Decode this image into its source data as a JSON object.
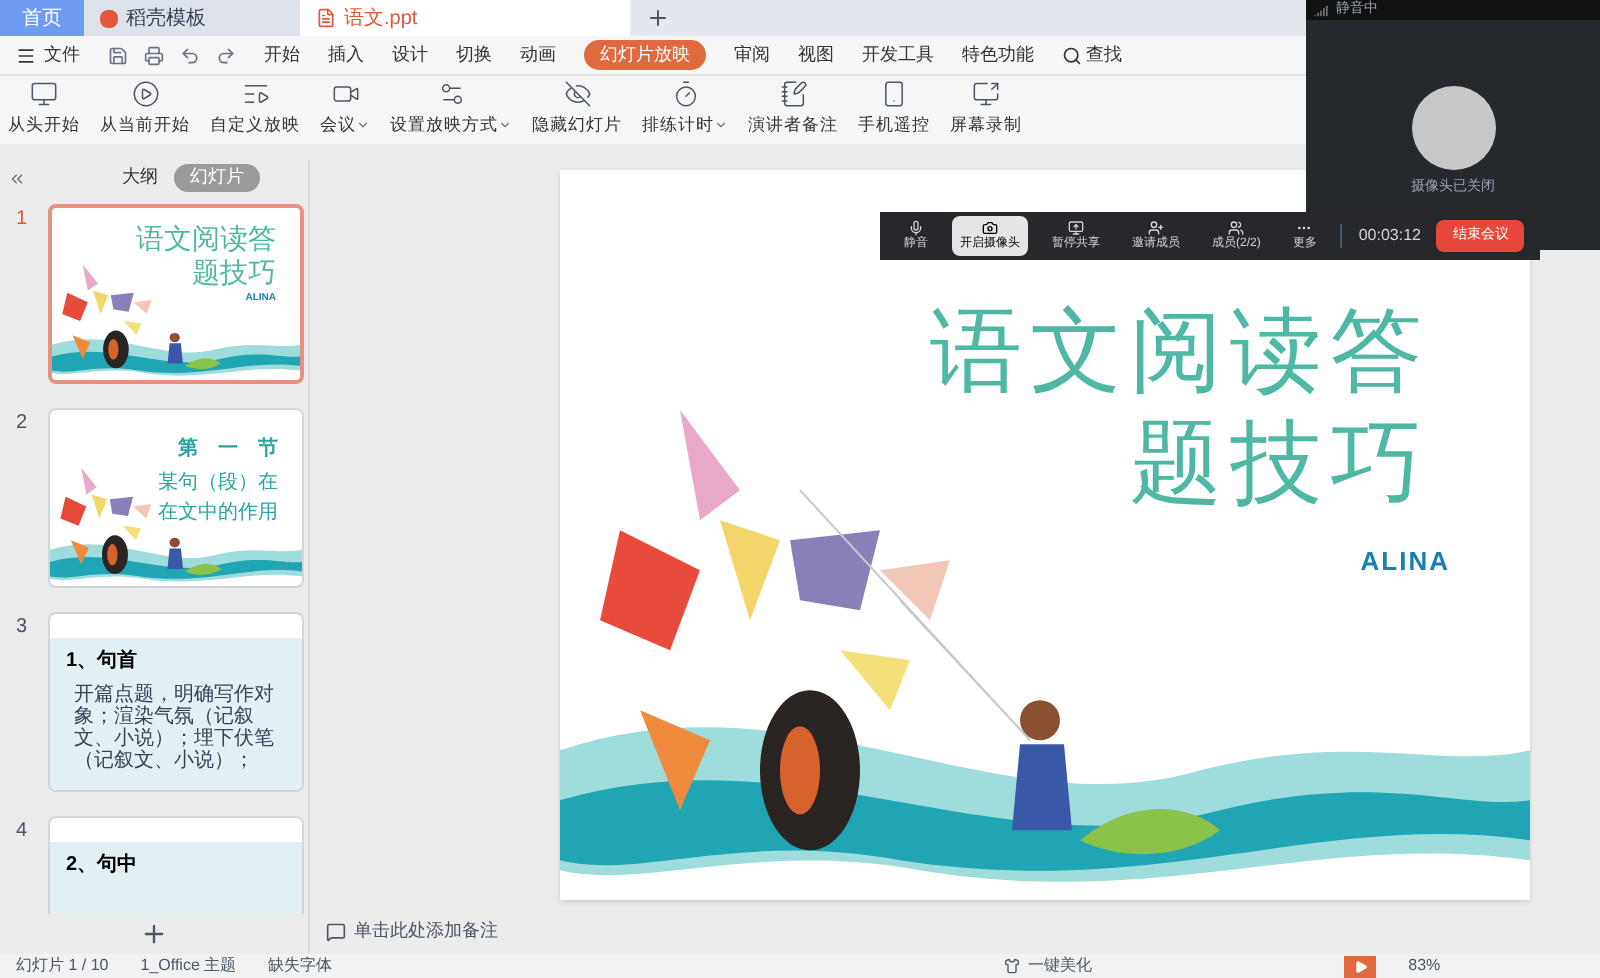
{
  "tabs": [
    {
      "label": "首页",
      "kind": "home",
      "selected": false
    },
    {
      "label": "稻壳模板",
      "kind": "template",
      "selected": false
    },
    {
      "label": "语文.ppt",
      "kind": "doc",
      "selected": true
    }
  ],
  "menu": {
    "file": "文件",
    "items": [
      {
        "label": "开始",
        "selected": false
      },
      {
        "label": "插入",
        "selected": false
      },
      {
        "label": "设计",
        "selected": false
      },
      {
        "label": "切换",
        "selected": false
      },
      {
        "label": "动画",
        "selected": false
      },
      {
        "label": "幻灯片放映",
        "selected": true
      },
      {
        "label": "审阅",
        "selected": false
      },
      {
        "label": "视图",
        "selected": false
      },
      {
        "label": "开发工具",
        "selected": false
      },
      {
        "label": "特色功能",
        "selected": false
      }
    ],
    "search": "查找"
  },
  "ribbon": [
    {
      "label": "从头开始",
      "kind": "monitor",
      "dropdown": false
    },
    {
      "label": "从当前开始",
      "kind": "play",
      "dropdown": false
    },
    {
      "label": "自定义放映",
      "kind": "list",
      "dropdown": false
    },
    {
      "label": "会议",
      "kind": "meeting",
      "dropdown": true
    },
    {
      "label": "设置放映方式",
      "kind": "settings",
      "dropdown": true
    },
    {
      "label": "隐藏幻灯片",
      "kind": "hide",
      "dropdown": false
    },
    {
      "label": "排练计时",
      "kind": "timer",
      "dropdown": true
    },
    {
      "label": "演讲者备注",
      "kind": "notes",
      "dropdown": false
    },
    {
      "label": "手机遥控",
      "kind": "phone",
      "dropdown": false
    },
    {
      "label": "屏幕录制",
      "kind": "record",
      "dropdown": false
    }
  ],
  "panel": {
    "tabs": [
      {
        "label": "大纲",
        "selected": false
      },
      {
        "label": "幻灯片",
        "selected": true
      }
    ],
    "slides": [
      {
        "number": "1",
        "kind": "title",
        "selected": true,
        "lines": [
          "语文阅读答",
          "题技巧"
        ],
        "author": "ALINA"
      },
      {
        "number": "2",
        "kind": "section",
        "selected": false,
        "heading": "第　一　节",
        "lines": [
          "某句（段）在",
          "在文中的作用"
        ]
      },
      {
        "number": "3",
        "kind": "text",
        "selected": false,
        "heading": "1、句首",
        "body": "开篇点题，明确写作对象；渲染气氛（记叙文、小说）；埋下伏笔（记叙文、小说）；"
      },
      {
        "number": "4",
        "kind": "text",
        "selected": false,
        "heading": "2、句中"
      }
    ]
  },
  "slide": {
    "lines": [
      "语文阅读答",
      "题技巧"
    ],
    "author": "ALINA"
  },
  "notes_placeholder": "单击此处添加备注",
  "meeting": {
    "buttons": [
      {
        "label": "静音",
        "kind": "mic",
        "selected": false
      },
      {
        "label": "开启摄像头",
        "kind": "camera",
        "selected": true
      },
      {
        "label": "暂停共享",
        "kind": "share",
        "selected": false
      },
      {
        "label": "邀请成员",
        "kind": "invite",
        "selected": false
      },
      {
        "label": "成员(2/2)",
        "kind": "members",
        "selected": false
      },
      {
        "label": "更多",
        "kind": "more",
        "selected": false
      }
    ],
    "timer": "00:03:12",
    "end": "结束会议"
  },
  "video": {
    "name": "静音中",
    "status": "摄像头已关闭"
  },
  "status_bar": {
    "slide": "幻灯片 1 / 10",
    "theme": "1_Office 主题",
    "font": "缺失字体",
    "beautify": "一键美化",
    "zoom": "83%"
  }
}
